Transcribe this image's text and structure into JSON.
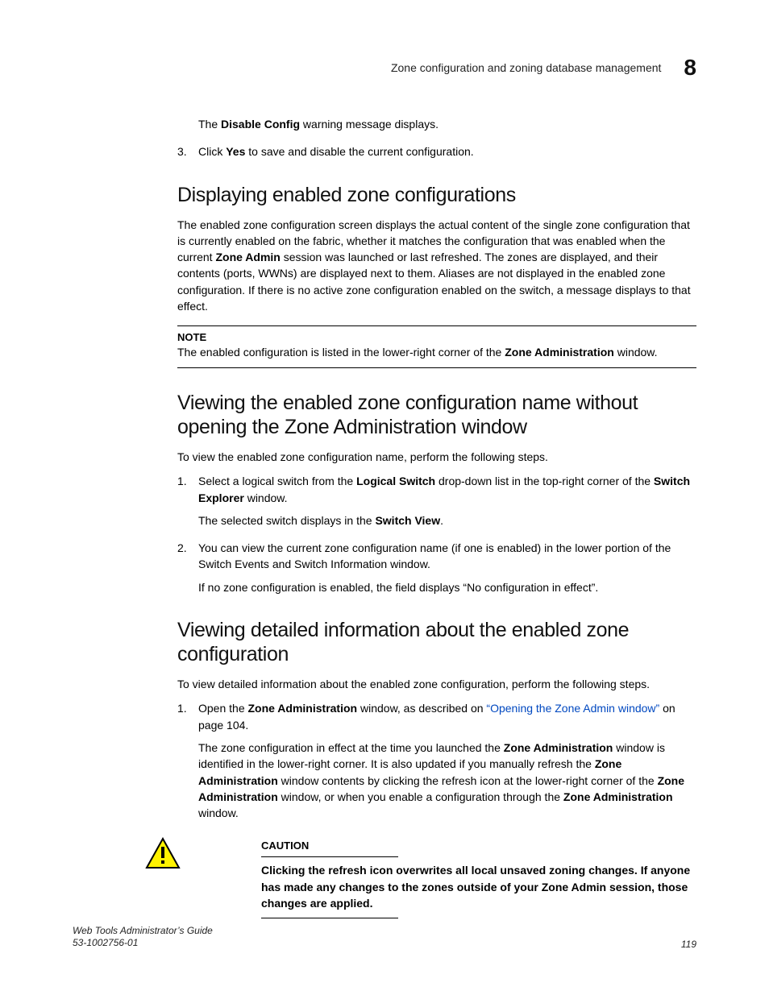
{
  "header": {
    "running_title": "Zone configuration and zoning database management",
    "chapter": "8"
  },
  "intro": {
    "disable_line_prefix": "The ",
    "disable_bold": "Disable Config",
    "disable_line_suffix": " warning message displays.",
    "step3_num": "3.",
    "step3_prefix": "Click ",
    "step3_bold": "Yes",
    "step3_suffix": " to save and disable the current configuration."
  },
  "sec1": {
    "title": "Displaying enabled zone configurations",
    "p1_a": "The enabled zone configuration screen displays the actual content of the single zone configuration that is currently enabled on the fabric, whether it matches the configuration that was enabled when the current ",
    "p1_b_bold": "Zone Admin",
    "p1_c": " session was launched or last refreshed. The zones are displayed, and their contents (ports, WWNs) are displayed next to them. Aliases are not displayed in the enabled zone configuration. If there is no active zone configuration enabled on the switch, a message displays to that effect.",
    "note_label": "NOTE",
    "note_a": "The enabled configuration is listed in the lower-right corner of the ",
    "note_b_bold": "Zone Administration",
    "note_c": " window."
  },
  "sec2": {
    "title": "Viewing the enabled zone configuration name without opening the Zone Administration window",
    "intro": "To view the enabled zone configuration name, perform the following steps.",
    "s1_num": "1.",
    "s1_a": "Select a logical switch from the ",
    "s1_b_bold": "Logical Switch",
    "s1_c": " drop-down list in the top-right corner of the ",
    "s1_d_bold": "Switch Explorer",
    "s1_e": " window.",
    "s1_sub_a": "The selected switch displays in the ",
    "s1_sub_b_bold": "Switch View",
    "s1_sub_c": ".",
    "s2_num": "2.",
    "s2_text": "You can view the current zone configuration name (if one is enabled) in the lower portion of the Switch Events and Switch Information window.",
    "s2_sub": "If no zone configuration is enabled, the field displays “No configuration in effect”."
  },
  "sec3": {
    "title": "Viewing detailed information about the enabled zone configuration",
    "intro": "To view detailed information about the enabled zone configuration, perform the following steps.",
    "s1_num": "1.",
    "s1_a": "Open the ",
    "s1_b_bold": "Zone Administration",
    "s1_c": " window, as described on ",
    "s1_link": "“Opening the Zone Admin window”",
    "s1_d": " on page 104.",
    "s1_sub_a": "The zone configuration in effect at the time you launched the ",
    "s1_sub_b_bold": "Zone Administration",
    "s1_sub_c": " window is identified in the lower-right corner. It is also updated if you manually refresh the ",
    "s1_sub_d_bold": "Zone Administration",
    "s1_sub_e": " window contents by clicking the refresh icon at the lower-right corner of the ",
    "s1_sub_f_bold": "Zone Administration",
    "s1_sub_g": " window, or when you enable a configuration through the ",
    "s1_sub_h_bold": "Zone Administration",
    "s1_sub_i": " window."
  },
  "caution": {
    "label": "CAUTION",
    "text": "Clicking the refresh icon overwrites all local unsaved zoning changes. If anyone has made any changes to the zones outside of your Zone Admin session, those changes are applied."
  },
  "footer": {
    "line1": "Web Tools Administrator’s Guide",
    "line2": "53-1002756-01",
    "page": "119"
  }
}
